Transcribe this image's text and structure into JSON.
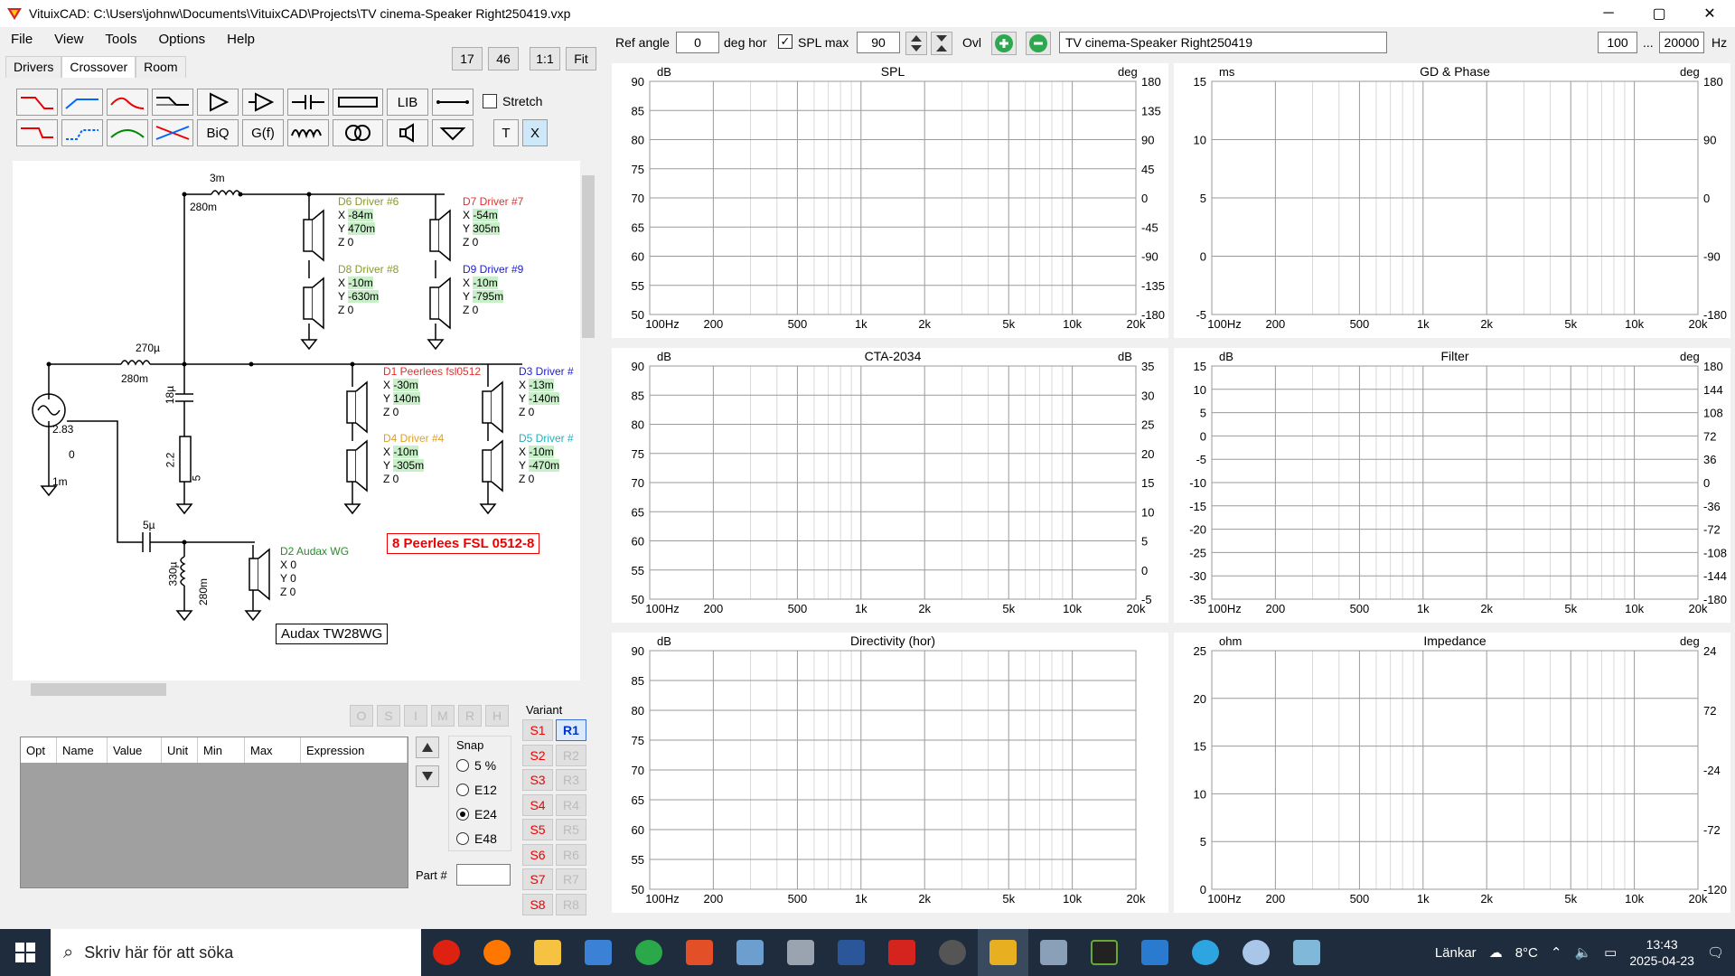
{
  "window": {
    "title": "VituixCAD: C:\\Users\\johnw\\Documents\\VituixCAD\\Projects\\TV cinema-Speaker Right250419.vxp",
    "minimize": "─",
    "maximize": "▢",
    "close": "✕"
  },
  "menu": [
    "File",
    "View",
    "Tools",
    "Options",
    "Help"
  ],
  "tabs": [
    "Drivers",
    "Crossover",
    "Room"
  ],
  "zoom_buttons": [
    "17",
    "46",
    "1:1",
    "Fit"
  ],
  "tools_row1": [
    "LIB"
  ],
  "tools_row2": [
    "BiQ",
    "G(f)",
    "T",
    "X"
  ],
  "stretch_label": "Stretch",
  "schematic": {
    "labels": [
      {
        "t": "3m"
      },
      {
        "t": "280m"
      },
      {
        "t": "270µ"
      },
      {
        "t": "280m"
      },
      {
        "t": "18µ"
      },
      {
        "t": "2.2"
      },
      {
        "t": "5"
      },
      {
        "t": "2.83"
      },
      {
        "t": "0"
      },
      {
        "t": "1m"
      },
      {
        "t": "5µ"
      },
      {
        "t": "330µ"
      },
      {
        "t": "280m"
      }
    ],
    "drivers": [
      {
        "name": "D6 Driver #6",
        "color": "#8a9a2a",
        "x": "-84m",
        "y": "470m",
        "z": "0"
      },
      {
        "name": "D7 Driver #7",
        "color": "#e03030",
        "x": "-54m",
        "y": "305m",
        "z": "0"
      },
      {
        "name": "D8 Driver #8",
        "color": "#8a9a2a",
        "x": "-10m",
        "y": "-630m",
        "z": "0"
      },
      {
        "name": "D9 Driver #9",
        "color": "#2020d0",
        "x": "-10m",
        "y": "-795m",
        "z": "0"
      },
      {
        "name": "D1 Peerlees fsl0512",
        "color": "#e03030",
        "x": "-30m",
        "y": "140m",
        "z": "0"
      },
      {
        "name": "D3 Driver #",
        "color": "#2020d0",
        "x": "-13m",
        "y": "-140m",
        "z": "0"
      },
      {
        "name": "D4 Driver #4",
        "color": "#e0a020",
        "x": "-10m",
        "y": "-305m",
        "z": "0"
      },
      {
        "name": "D5 Driver #",
        "color": "#20b0c0",
        "x": "-10m",
        "y": "-470m",
        "z": "0"
      },
      {
        "name": "D2 Audax WG",
        "color": "#2a8a2a",
        "x": "0",
        "y": "0",
        "z": "0"
      }
    ],
    "note_box": "8 Peerlees FSL 0512-8",
    "part_box": "Audax TW28WG"
  },
  "status_letters": [
    "O",
    "S",
    "I",
    "M",
    "R",
    "H"
  ],
  "param_table": {
    "headers": [
      "Opt",
      "Name",
      "Value",
      "Unit",
      "Min",
      "Max",
      "Expression"
    ]
  },
  "snap": {
    "label": "Snap",
    "options": [
      "5 %",
      "E12",
      "E24",
      "E48"
    ],
    "selected": "E24"
  },
  "part_no_label": "Part #",
  "variant": {
    "label": "Variant",
    "s": [
      "S1",
      "S2",
      "S3",
      "S4",
      "S5",
      "S6",
      "S7",
      "S8"
    ],
    "r": [
      "R1",
      "R2",
      "R3",
      "R4",
      "R5",
      "R6",
      "R7",
      "R8"
    ]
  },
  "toolbar_right": {
    "ref_angle_label": "Ref angle",
    "ref_angle_value": "0",
    "deg_hor": "deg hor",
    "spl_max_label": "SPL max",
    "spl_max_value": "90",
    "ovl": "Ovl",
    "project_name": "TV cinema-Speaker Right250419",
    "f_min": "100",
    "ellipsis": "...",
    "f_max": "20000",
    "hz": "Hz"
  },
  "freq_ticks": [
    "100Hz",
    "200",
    "500",
    "1k",
    "2k",
    "5k",
    "10k",
    "20k"
  ],
  "charts": [
    {
      "title": "SPL",
      "ylabel_left": "dB",
      "ylabel_right": "deg",
      "yl": [
        "90",
        "85",
        "80",
        "75",
        "70",
        "65",
        "60",
        "55",
        "50"
      ],
      "yr": [
        "180",
        "135",
        "90",
        "45",
        "0",
        "-45",
        "-90",
        "-135",
        "-180"
      ]
    },
    {
      "title": "GD & Phase",
      "ylabel_left": "ms",
      "ylabel_right": "deg",
      "yl": [
        "15",
        "10",
        "5",
        "0",
        "-5"
      ],
      "yr": [
        "180",
        "90",
        "0",
        "-90",
        "-180"
      ]
    },
    {
      "title": "CTA-2034",
      "ylabel_left": "dB",
      "ylabel_right": "dB",
      "yl": [
        "90",
        "85",
        "80",
        "75",
        "70",
        "65",
        "60",
        "55",
        "50"
      ],
      "yr": [
        "35",
        "30",
        "25",
        "20",
        "15",
        "10",
        "5",
        "0",
        "-5"
      ]
    },
    {
      "title": "Filter",
      "ylabel_left": "dB",
      "ylabel_right": "deg",
      "yl": [
        "15",
        "10",
        "5",
        "0",
        "-5",
        "-10",
        "-15",
        "-20",
        "-25",
        "-30",
        "-35"
      ],
      "yr": [
        "180",
        "144",
        "108",
        "72",
        "36",
        "0",
        "-36",
        "-72",
        "-108",
        "-144",
        "-180"
      ]
    },
    {
      "title": "Directivity (hor)",
      "ylabel_left": "dB",
      "ylabel_right": "",
      "yl": [
        "90",
        "85",
        "80",
        "75",
        "70",
        "65",
        "60",
        "55",
        "50"
      ],
      "yr": []
    },
    {
      "title": "Impedance",
      "ylabel_left": "ohm",
      "ylabel_right": "deg",
      "yl": [
        "25",
        "20",
        "15",
        "10",
        "5",
        "0"
      ],
      "yr": [
        "24",
        "72",
        "-24",
        "-72",
        "-120"
      ]
    }
  ],
  "taskbar": {
    "search": "Skriv här för att söka",
    "links": "Länkar",
    "temp": "8°C",
    "time": "13:43",
    "date": "2025-04-23"
  }
}
